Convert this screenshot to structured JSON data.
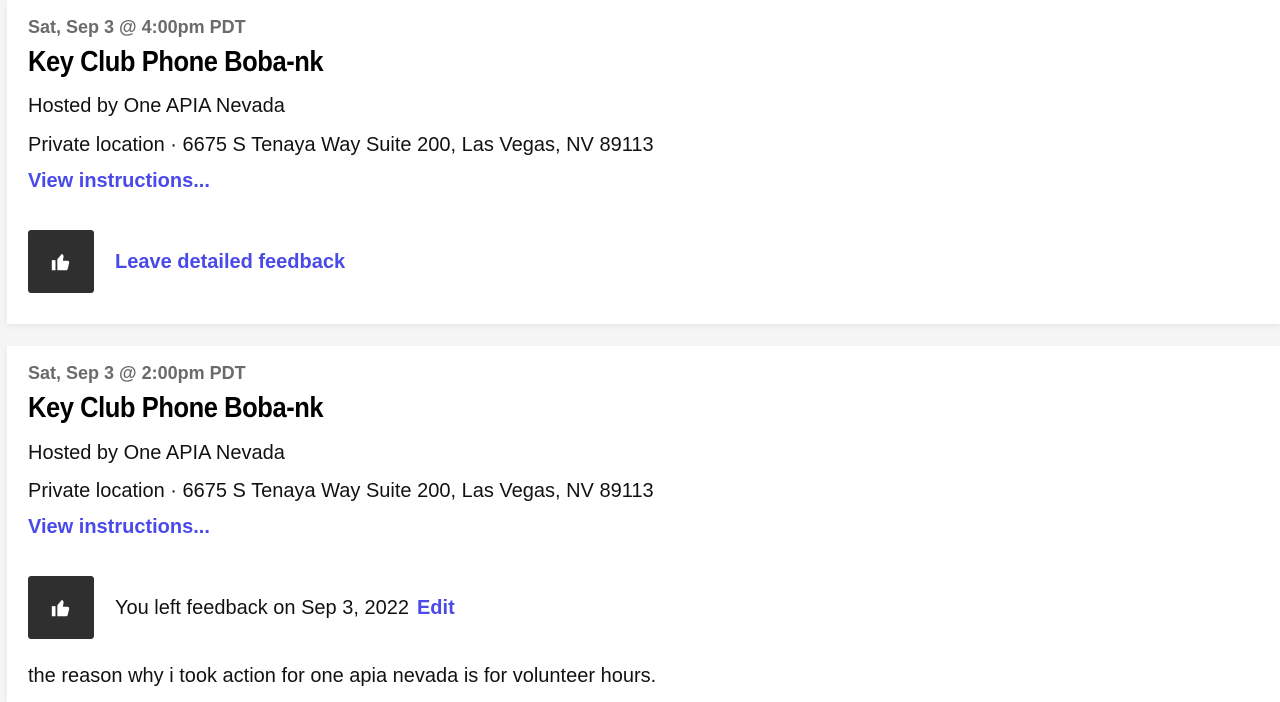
{
  "events": [
    {
      "date": "Sat, Sep 3 @ 4:00pm PDT",
      "title": "Key Club Phone Boba-nk",
      "host": "Hosted by One APIA Nevada",
      "location": "Private location · 6675 S Tenaya Way Suite 200, Las Vegas, NV 89113",
      "instructions_link": "View instructions...",
      "feedback_link": "Leave detailed feedback"
    },
    {
      "date": "Sat, Sep 3 @ 2:00pm PDT",
      "title": "Key Club Phone Boba-nk",
      "host": "Hosted by One APIA Nevada",
      "location": "Private location · 6675 S Tenaya Way Suite 200, Las Vegas, NV 89113",
      "instructions_link": "View instructions...",
      "feedback_status": "You left feedback on Sep 3, 2022",
      "edit_link": "Edit",
      "feedback_comment": "the reason why i took action for one apia nevada is for volunteer hours."
    }
  ],
  "colors": {
    "link": "#4a4ae8",
    "button_bg": "#2f2f2f",
    "muted_text": "#6b6b6b"
  },
  "icons": {
    "feedback_button": "thumbs-up-icon"
  }
}
